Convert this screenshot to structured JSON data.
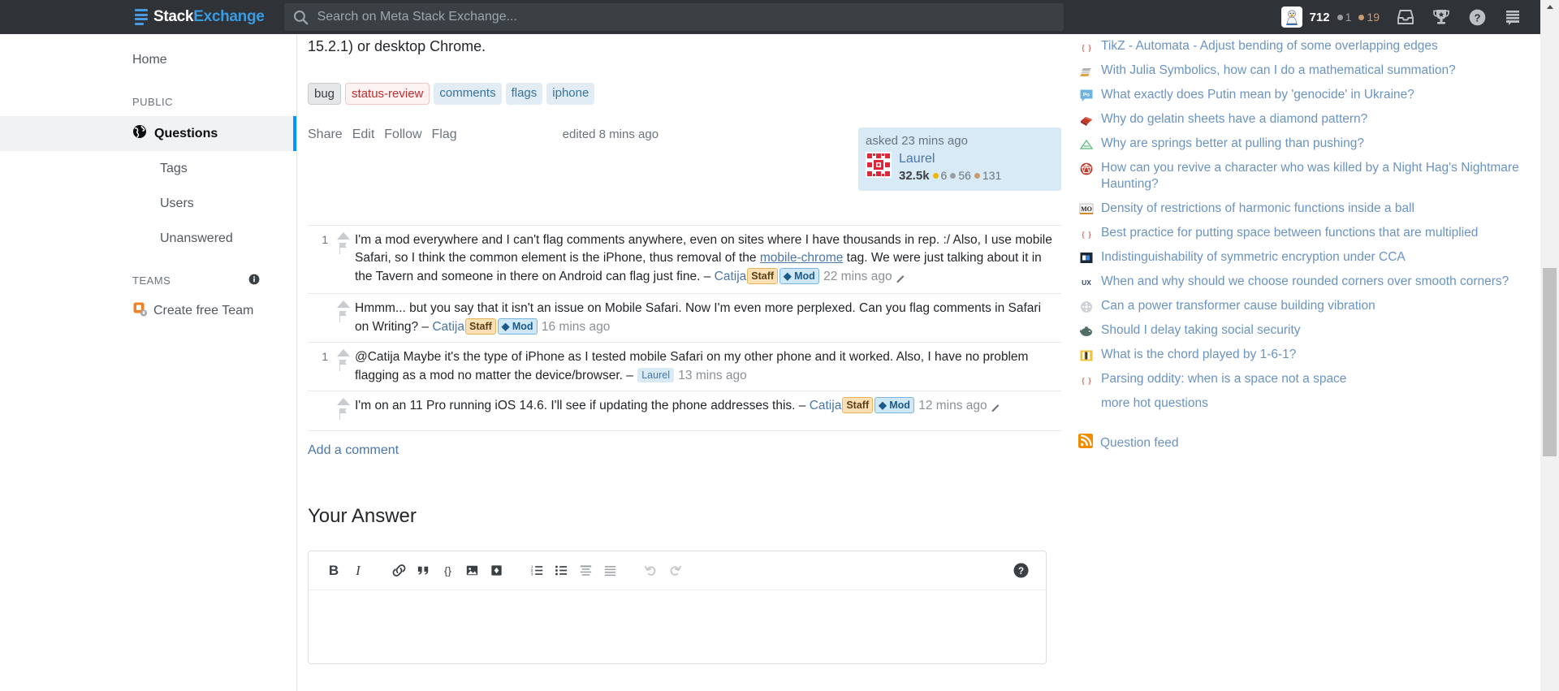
{
  "topbar": {
    "logo_first": "Stack",
    "logo_second": "Exchange",
    "search_placeholder": "Search on Meta Stack Exchange...",
    "search_value": "",
    "reputation": "712",
    "silver_badges": "1",
    "gold_badges": "19",
    "icons": [
      "inbox-icon",
      "achievements-icon",
      "help-icon",
      "site-switcher-icon"
    ]
  },
  "sidebar": {
    "home_label": "Home",
    "public_heading": "PUBLIC",
    "items": [
      {
        "label": "Questions",
        "icon": "globe-icon",
        "active": true
      },
      {
        "label": "Tags",
        "icon": "",
        "active": false
      },
      {
        "label": "Users",
        "icon": "",
        "active": false
      },
      {
        "label": "Unanswered",
        "icon": "",
        "active": false
      }
    ],
    "teams_heading": "TEAMS",
    "teams_info_icon": "info-icon",
    "create_team_label": "Create free Team"
  },
  "post": {
    "body_tail": "15.2.1) or desktop Chrome.",
    "tags": [
      {
        "label": "bug",
        "style": "grey"
      },
      {
        "label": "status-review",
        "style": "status"
      },
      {
        "label": "comments",
        "style": "default"
      },
      {
        "label": "flags",
        "style": "default"
      },
      {
        "label": "iphone",
        "style": "default"
      }
    ],
    "menu": [
      "Share",
      "Edit",
      "Follow",
      "Flag"
    ],
    "edited_text": "edited 8 mins ago",
    "asked_text": "asked 23 mins ago",
    "asked_user": "Laurel",
    "asked_rep": "32.5k",
    "asked_gold": "6",
    "asked_silver": "56",
    "asked_bronze": "131"
  },
  "comments": [
    {
      "score": "1",
      "text_parts": [
        {
          "t": "I'm a mod everywhere and I can't flag comments anywhere, even on sites where I have thousands in rep. :/ Also, I use mobile Safari, so I think the common element is the iPhone, thus removal of the ",
          "k": "text"
        },
        {
          "t": "mobile-chrome",
          "k": "link"
        },
        {
          "t": " tag. We were just talking about it in the Tavern and someone in there on Android can flag just fine. – ",
          "k": "text"
        },
        {
          "t": "Catija",
          "k": "user"
        },
        {
          "t": "Staff",
          "k": "staff"
        },
        {
          "t": "Mod",
          "k": "mod"
        },
        {
          "t": "22 mins ago",
          "k": "time"
        },
        {
          "t": "edit-pencil",
          "k": "pencil"
        }
      ]
    },
    {
      "score": "",
      "text_parts": [
        {
          "t": "Hmmm... but you say that it isn't an issue on Mobile Safari. Now I'm even more perplexed. Can you flag comments in Safari on Writing? – ",
          "k": "text"
        },
        {
          "t": "Catija",
          "k": "user"
        },
        {
          "t": "Staff",
          "k": "staff"
        },
        {
          "t": "Mod",
          "k": "mod"
        },
        {
          "t": "16 mins ago",
          "k": "time"
        }
      ]
    },
    {
      "score": "1",
      "text_parts": [
        {
          "t": "@Catija Maybe it's the type of iPhone as I tested mobile Safari on my other phone and it worked. Also, I have no problem flagging as a mod no matter the device/browser. – ",
          "k": "text"
        },
        {
          "t": "Laurel",
          "k": "laurel"
        },
        {
          "t": "13 mins ago",
          "k": "time"
        }
      ]
    },
    {
      "score": "",
      "text_parts": [
        {
          "t": "I'm on an 11 Pro running iOS 14.6. I'll see if updating the phone addresses this. – ",
          "k": "text"
        },
        {
          "t": "Catija",
          "k": "user"
        },
        {
          "t": "Staff",
          "k": "staff"
        },
        {
          "t": "Mod",
          "k": "mod"
        },
        {
          "t": "12 mins ago",
          "k": "time"
        },
        {
          "t": "edit-pencil",
          "k": "pencil"
        }
      ]
    }
  ],
  "add_comment_label": "Add a comment",
  "answer": {
    "heading": "Your Answer",
    "editor_value": "",
    "toolbar": [
      {
        "name": "bold-icon",
        "glyph": "B",
        "disabled": false
      },
      {
        "name": "italic-icon",
        "glyph": "I",
        "disabled": false
      },
      {
        "name": "link-icon",
        "glyph": "",
        "disabled": false
      },
      {
        "name": "blockquote-icon",
        "glyph": "",
        "disabled": false
      },
      {
        "name": "inline-code-icon",
        "glyph": "{}",
        "disabled": false
      },
      {
        "name": "image-icon",
        "glyph": "",
        "disabled": false
      },
      {
        "name": "code-block-icon",
        "glyph": "",
        "disabled": false
      },
      {
        "name": "ordered-list-icon",
        "glyph": "",
        "disabled": false
      },
      {
        "name": "bulleted-list-icon",
        "glyph": "",
        "disabled": false
      },
      {
        "name": "heading-icon",
        "glyph": "",
        "disabled": false
      },
      {
        "name": "horizontal-rule-icon",
        "glyph": "",
        "disabled": false
      },
      {
        "name": "undo-icon",
        "glyph": "",
        "disabled": true
      },
      {
        "name": "redo-icon",
        "glyph": "",
        "disabled": true
      }
    ],
    "help_icon": "help-icon"
  },
  "hot_questions": {
    "items": [
      {
        "title": "TikZ - Automata - Adjust bending of some overlapping edges",
        "site": "tex"
      },
      {
        "title": "With Julia Symbolics, how can I do a mathematical summation?",
        "site": "julia"
      },
      {
        "title": "What exactly does Putin mean by 'genocide' in Ukraine?",
        "site": "politics"
      },
      {
        "title": "Why do gelatin sheets have a diamond pattern?",
        "site": "cooking"
      },
      {
        "title": "Why are springs better at pulling than pushing?",
        "site": "physics"
      },
      {
        "title": "How can you revive a character who was killed by a Night Hag's Nightmare Haunting?",
        "site": "rpg"
      },
      {
        "title": "Density of restrictions of harmonic functions inside a ball",
        "site": "mathoverflow"
      },
      {
        "title": "Best practice for putting space between functions that are multiplied",
        "site": "tex"
      },
      {
        "title": "Indistinguishability of symmetric encryption under CCA",
        "site": "crypto"
      },
      {
        "title": "When and why should we choose rounded corners over smooth corners?",
        "site": "ux"
      },
      {
        "title": "Can a power transformer cause building vibration",
        "site": "engineering"
      },
      {
        "title": "Should I delay taking social security",
        "site": "money"
      },
      {
        "title": "What is the chord played by 1-6-1?",
        "site": "music"
      },
      {
        "title": "Parsing oddity: when is a space not a space",
        "site": "tex"
      }
    ],
    "more_label": "more hot questions",
    "question_feed_label": "Question feed"
  },
  "colors": {
    "topbar_bg": "#2f3337",
    "accent_blue": "#0095ff",
    "link_blue": "#4a76a8",
    "hot_link": "#6a93c0",
    "tag_bg": "#e1ecf4",
    "tag_fg": "#39739d",
    "asked_card_bg": "#d9eaf7"
  }
}
